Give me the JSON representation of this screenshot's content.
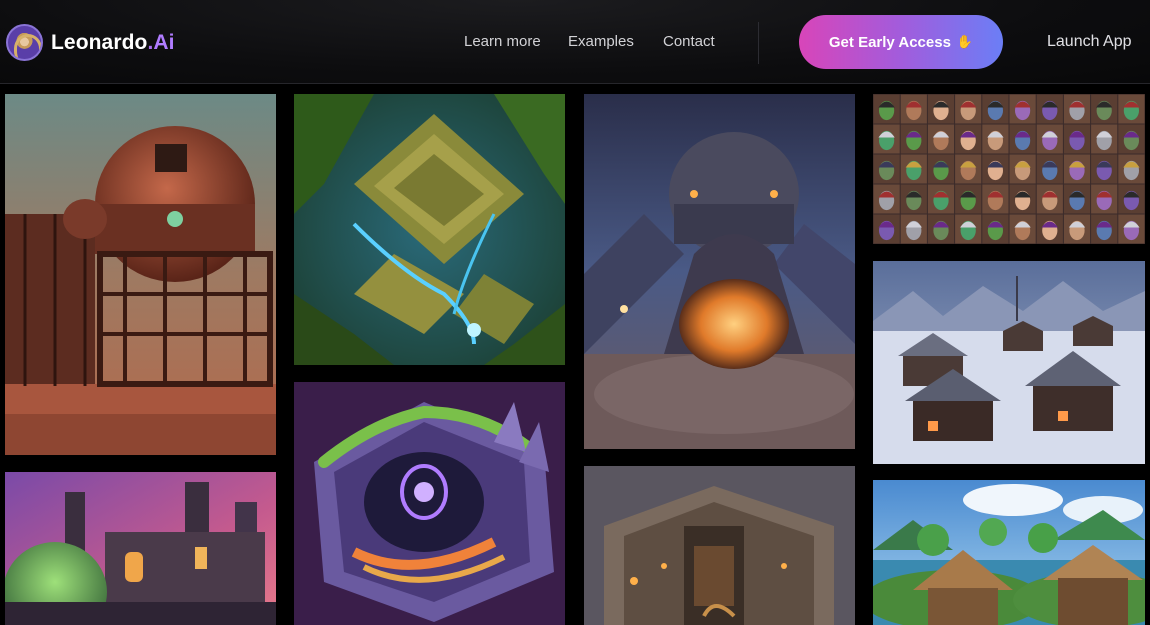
{
  "brand": {
    "name": "Leonardo",
    "dot": ".",
    "suffix": "Ai"
  },
  "nav": {
    "links": [
      "Learn more",
      "Examples",
      "Contact"
    ],
    "cta_label": "Get Early Access",
    "cta_icon": "waving-hand-icon",
    "launch_label": "Launch App"
  },
  "colors": {
    "cta_gradient_start": "#d845b9",
    "cta_gradient_end": "#6b7ef6",
    "brand_accent": "#b07cff",
    "background": "#000000"
  },
  "gallery": {
    "tiles": [
      {
        "subject": "steampunk-dome-on-red-desert"
      },
      {
        "subject": "jungle-temple-pyramid-with-waterfalls"
      },
      {
        "subject": "sci-fi-dome-pod-on-rocky-terrain"
      },
      {
        "subject": "grid-of-fantasy-character-portraits"
      },
      {
        "subject": "snowy-village-with-wooden-houses"
      },
      {
        "subject": "industrial-factory-towers-at-dusk"
      },
      {
        "subject": "isometric-crystal-cave-with-portal"
      },
      {
        "subject": "isometric-stone-ruins-interior"
      },
      {
        "subject": "tropical-island-huts"
      }
    ]
  }
}
